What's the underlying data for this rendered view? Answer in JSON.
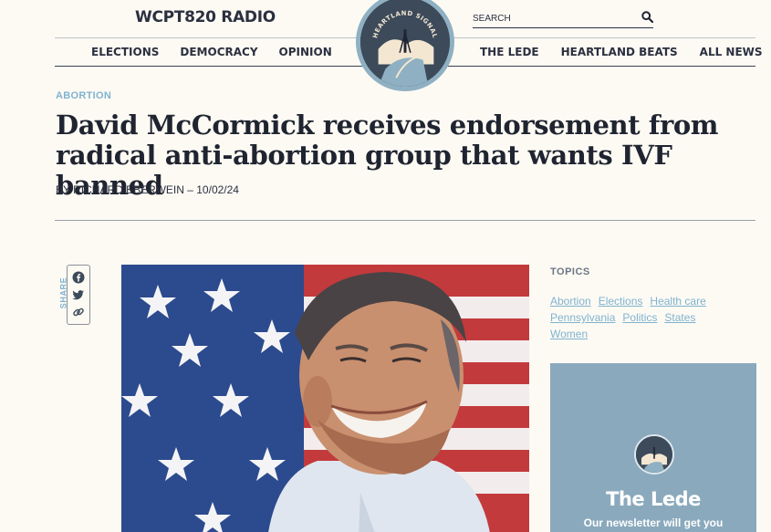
{
  "header": {
    "site_name": "WCPT820 RADIO",
    "search_placeholder": "SEARCH",
    "logo_text": "HEARTLAND SIGNAL"
  },
  "nav": {
    "left": [
      "ELECTIONS",
      "DEMOCRACY",
      "OPINION"
    ],
    "right": [
      "THE LEDE",
      "HEARTLAND BEATS",
      "ALL NEWS"
    ]
  },
  "article": {
    "category": "ABORTION",
    "headline": "David McCormick receives endorsement from radical anti-abortion group that wants IVF banned",
    "byline": "BY RICHARD EBERWEIN – 10/02/24"
  },
  "share": {
    "label": "SHARE",
    "icons": [
      "facebook-icon",
      "twitter-icon",
      "link-icon"
    ]
  },
  "sidebar": {
    "topics_title": "TOPICS",
    "topics": [
      "Abortion",
      "Elections",
      "Health care",
      "Pennsylvania",
      "Politics",
      "States",
      "Women"
    ],
    "promo_title": "The Lede",
    "promo_text": "Our newsletter will get you"
  },
  "colors": {
    "background": "#fdfaf4",
    "accent": "#7fb3cf",
    "promo": "#8aa9bc",
    "logo_dark": "#3c4a5a"
  }
}
